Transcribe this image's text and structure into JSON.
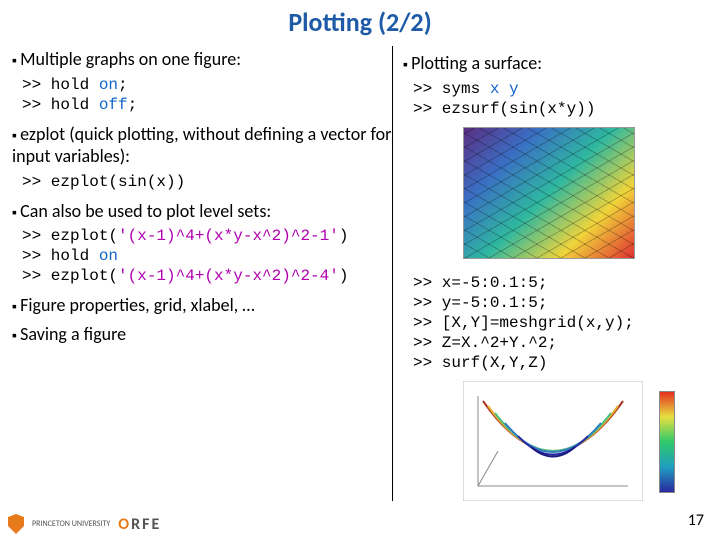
{
  "title": "Plotting (2/2)",
  "left": {
    "b1": "Multiple graphs on one figure:",
    "code1_l1_a": ">> hold ",
    "code1_l1_b": "on",
    "code1_l1_c": ";",
    "code1_l2_a": ">> hold ",
    "code1_l2_b": "off",
    "code1_l2_c": ";",
    "b2": "ezplot (quick plotting, without defining a vector for input variables):",
    "code2": ">> ezplot(sin(x))",
    "b3": "Can also be used to plot level sets:",
    "code3_l1_a": ">> ezplot(",
    "code3_l1_b": "'(x-1)^4+(x*y-x^2)^2-1'",
    "code3_l1_c": ")",
    "code3_l2_a": ">> hold ",
    "code3_l2_b": "on",
    "code3_l3_a": ">> ezplot(",
    "code3_l3_b": "'(x-1)^4+(x*y-x^2)^2-4'",
    "code3_l3_c": ")",
    "b4": "Figure properties, grid, xlabel, …",
    "b5": "Saving a figure"
  },
  "right": {
    "b1": "Plotting a surface:",
    "code1_l1_a": ">> syms ",
    "code1_l1_b": "x y",
    "code1_l2": ">> ezsurf(sin(x*y))",
    "code2_l1": ">> x=-5:0.1:5;",
    "code2_l2": ">> y=-5:0.1:5;",
    "code2_l3": ">> [X,Y]=meshgrid(x,y);",
    "code2_l4": ">> Z=X.^2+Y.^2;",
    "code2_l5": ">> surf(X,Y,Z)"
  },
  "footer": {
    "univ": "PRINCETON UNIVERSITY",
    "orfe": "ORFE",
    "page": "17"
  },
  "chart_data": [
    {
      "type": "surface",
      "title": "sin(x*y)",
      "x_range": [
        -6,
        6
      ],
      "y_range": [
        -6,
        6
      ],
      "z_range": [
        -1,
        1
      ],
      "function": "sin(x*y)",
      "colormap": "jet"
    },
    {
      "type": "surface",
      "title": "",
      "x_range": [
        -5,
        5
      ],
      "y_range": [
        -5,
        5
      ],
      "z_range": [
        0,
        50
      ],
      "function": "X.^2 + Y.^2",
      "colormap": "jet",
      "colorbar": true
    }
  ]
}
